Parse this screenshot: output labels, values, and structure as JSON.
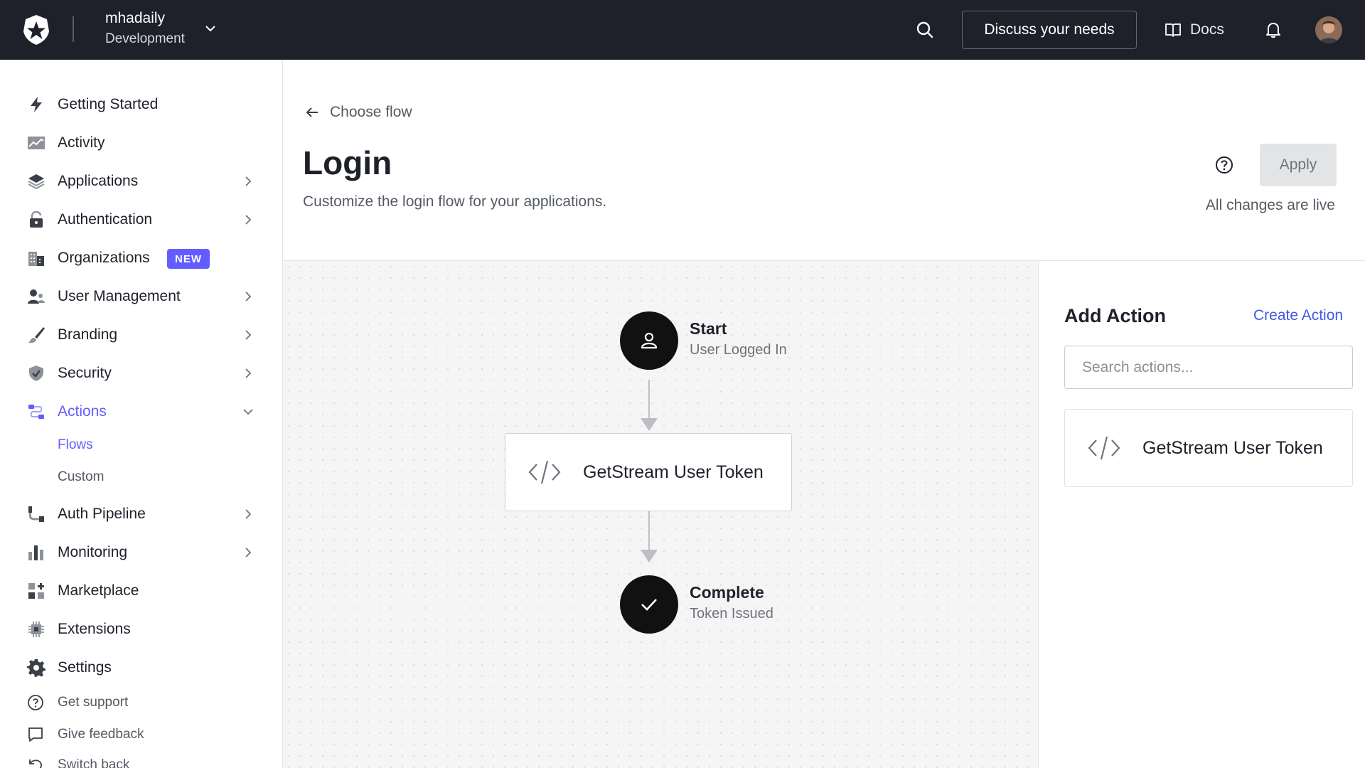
{
  "topbar": {
    "tenant_name": "mhadaily",
    "tenant_env": "Development",
    "discuss_label": "Discuss your needs",
    "docs_label": "Docs"
  },
  "sidebar": {
    "items": [
      {
        "label": "Getting Started",
        "icon": "bolt-icon"
      },
      {
        "label": "Activity",
        "icon": "activity-chart-icon"
      },
      {
        "label": "Applications",
        "icon": "layers-icon"
      },
      {
        "label": "Authentication",
        "icon": "lock-icon"
      },
      {
        "label": "Organizations",
        "icon": "building-icon",
        "badge": "NEW"
      },
      {
        "label": "User Management",
        "icon": "users-icon"
      },
      {
        "label": "Branding",
        "icon": "brush-icon"
      },
      {
        "label": "Security",
        "icon": "shield-icon"
      },
      {
        "label": "Actions",
        "icon": "actions-icon",
        "active": true
      },
      {
        "label": "Auth Pipeline",
        "icon": "pipeline-icon"
      },
      {
        "label": "Monitoring",
        "icon": "bar-chart-icon"
      },
      {
        "label": "Marketplace",
        "icon": "grid-plus-icon"
      },
      {
        "label": "Extensions",
        "icon": "chip-icon"
      },
      {
        "label": "Settings",
        "icon": "gear-icon"
      }
    ],
    "sub_items": [
      {
        "label": "Flows",
        "active": true
      },
      {
        "label": "Custom"
      }
    ],
    "footer": [
      {
        "label": "Get support",
        "icon": "help-circle-icon"
      },
      {
        "label": "Give feedback",
        "icon": "message-icon"
      },
      {
        "label": "Switch back",
        "icon": "undo-icon"
      }
    ]
  },
  "header": {
    "back_label": "Choose flow",
    "title": "Login",
    "subtitle": "Customize the login flow for your applications.",
    "apply_label": "Apply",
    "live_text": "All changes are live"
  },
  "flow": {
    "start_title": "Start",
    "start_sub": "User Logged In",
    "action_label": "GetStream User Token",
    "end_title": "Complete",
    "end_sub": "Token Issued"
  },
  "panel": {
    "title": "Add Action",
    "create_label": "Create Action",
    "search_placeholder": "Search actions...",
    "library_item": "GetStream User Token"
  },
  "colors": {
    "topbar_bg": "#1e212a",
    "accent": "#635dff",
    "link": "#3f59e4",
    "canvas_bg": "#f5f5f6"
  }
}
